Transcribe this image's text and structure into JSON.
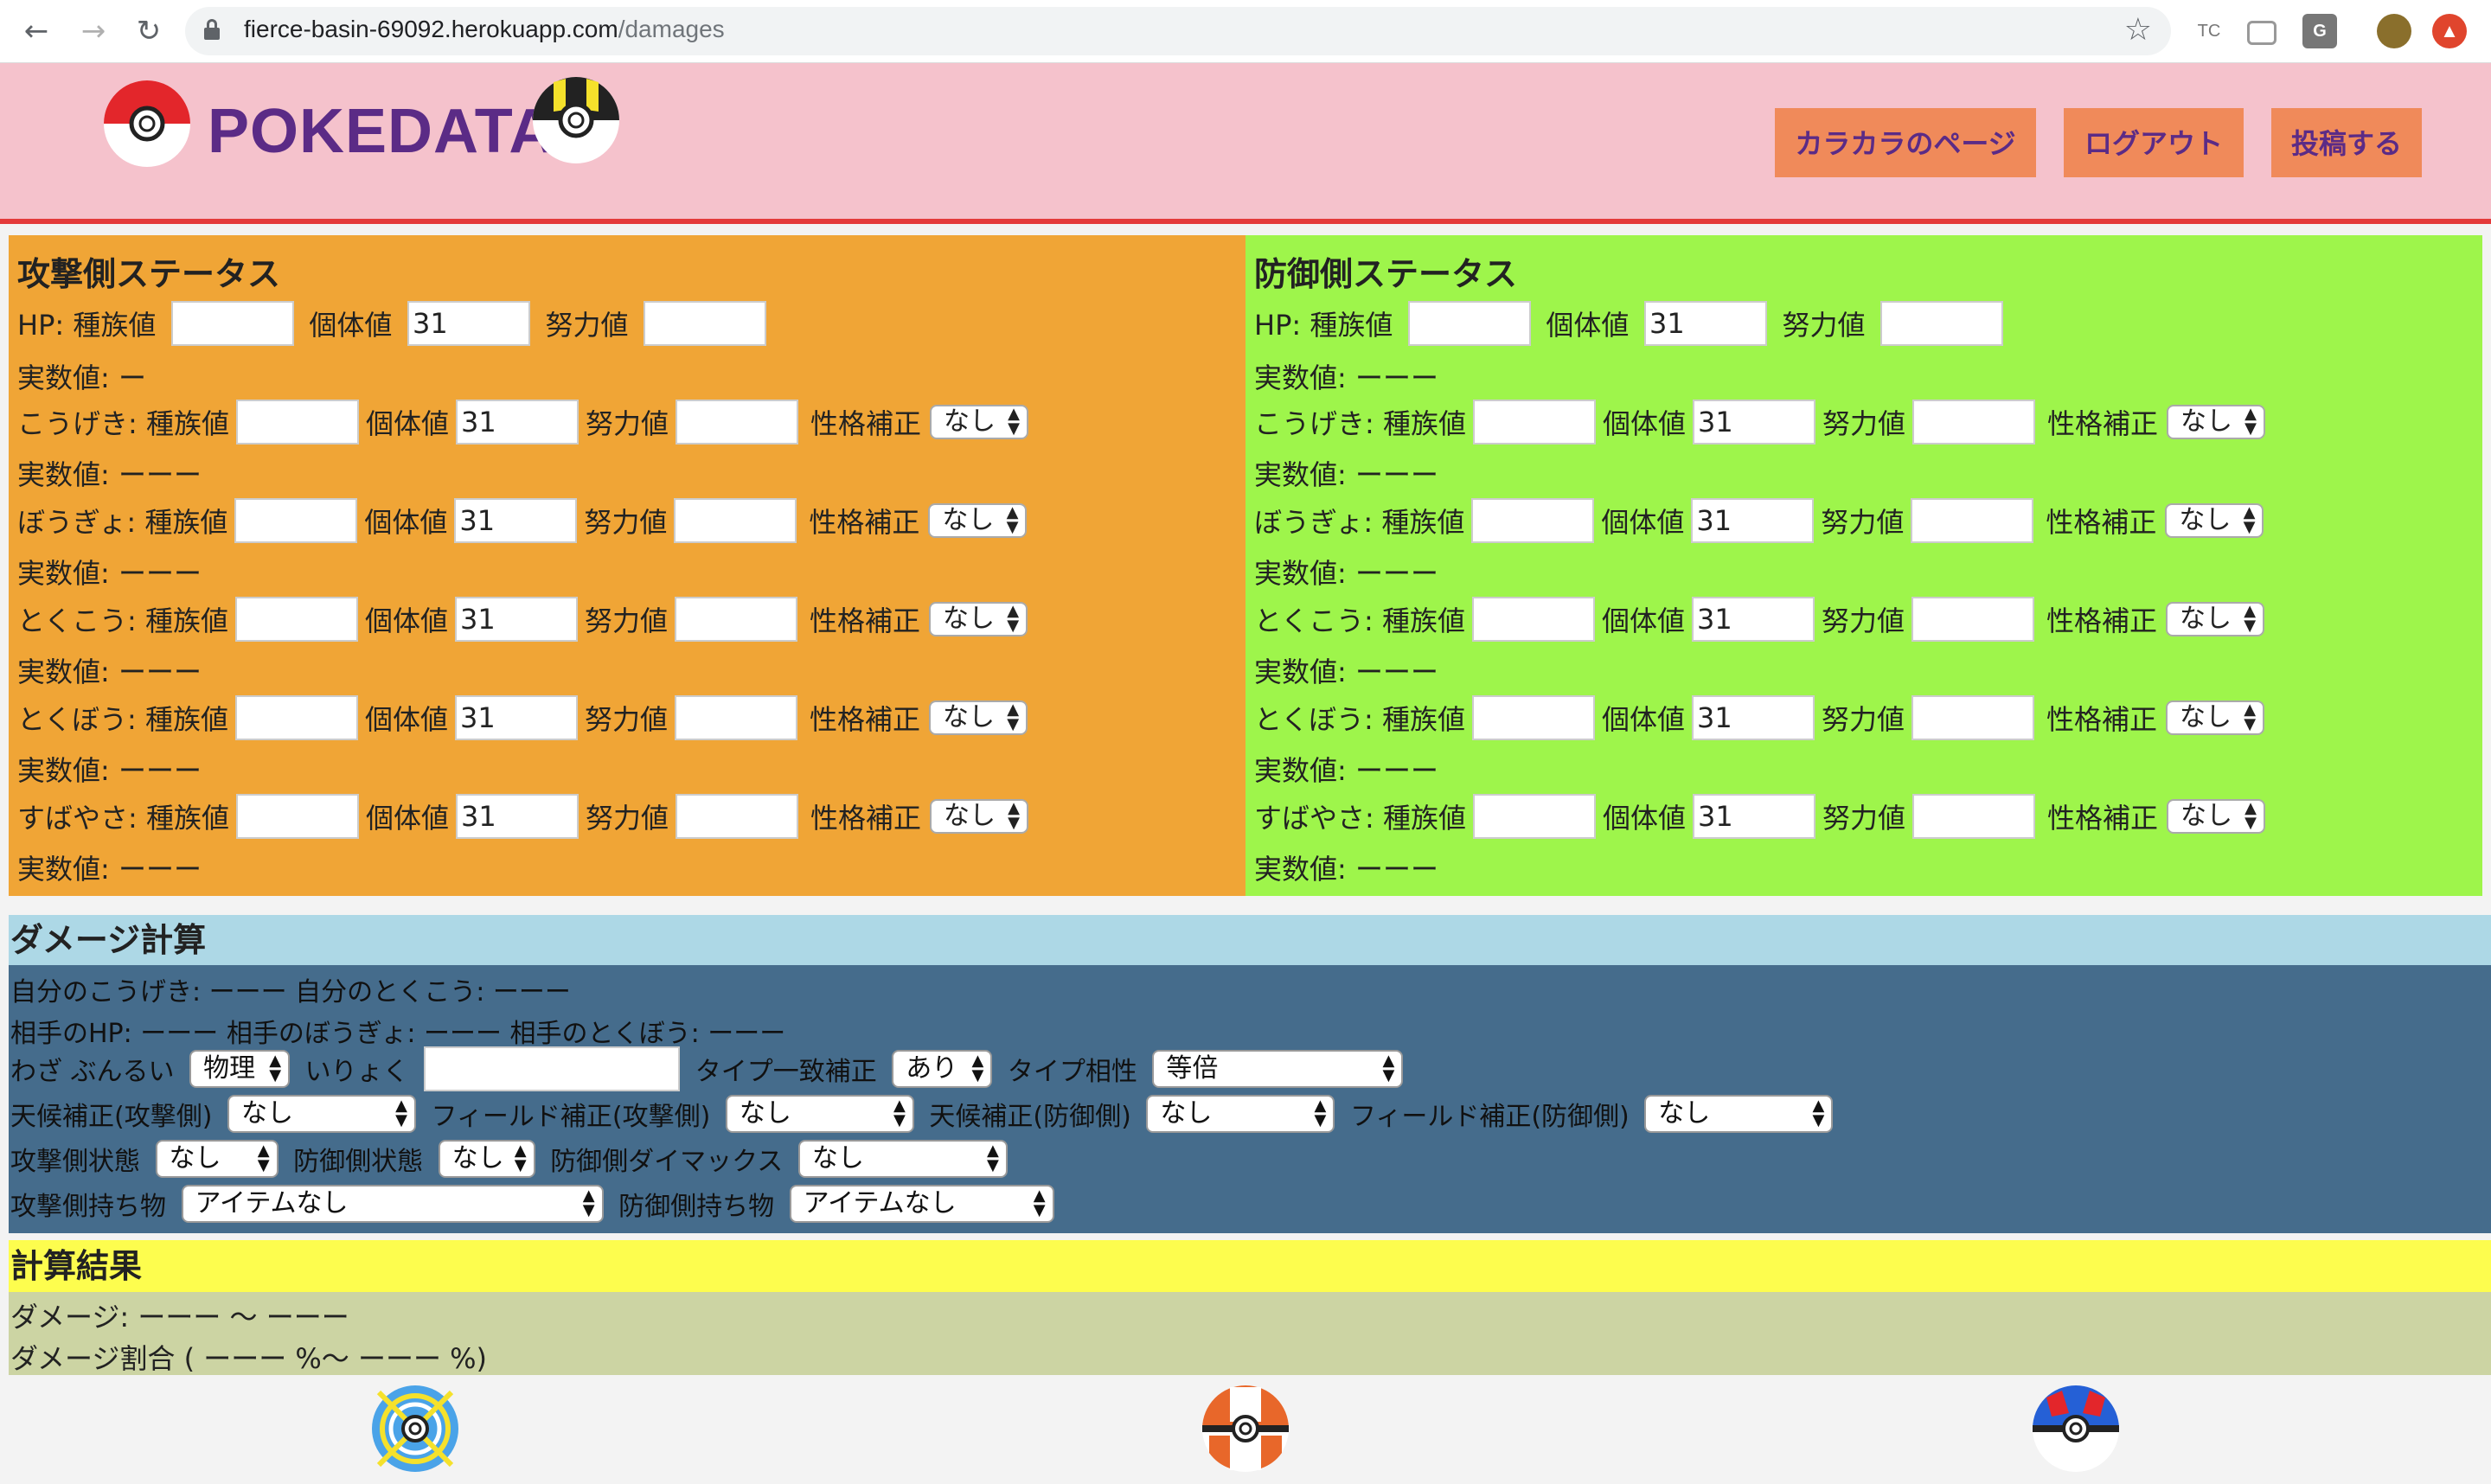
{
  "browser": {
    "url_host": "fierce-basin-69092.herokuapp.com",
    "url_path": "/damages",
    "ext_tc": "TC",
    "ext_g": "G"
  },
  "header": {
    "logo": "POKEDATA",
    "buttons": {
      "karakara": "カラカラのページ",
      "logout": "ログアウト",
      "post": "投稿する"
    }
  },
  "attacker": {
    "title": "攻撃側ステータス",
    "hp": {
      "label": "HP: 種族値",
      "iv_label": "個体値",
      "iv": "31",
      "ev_label": "努力値",
      "actual": "実数値: ー"
    },
    "stats": [
      {
        "label": "こうげき: 種族値",
        "iv_label": "個体値",
        "iv": "31",
        "ev_label": "努力値",
        "nature_label": "性格補正",
        "nature": "なし",
        "actual": "実数値: ーーー"
      },
      {
        "label": "ぼうぎょ: 種族値",
        "iv_label": "個体値",
        "iv": "31",
        "ev_label": "努力値",
        "nature_label": "性格補正",
        "nature": "なし",
        "actual": "実数値: ーーー"
      },
      {
        "label": "とくこう: 種族値",
        "iv_label": "個体値",
        "iv": "31",
        "ev_label": "努力値",
        "nature_label": "性格補正",
        "nature": "なし",
        "actual": "実数値: ーーー"
      },
      {
        "label": "とくぼう: 種族値",
        "iv_label": "個体値",
        "iv": "31",
        "ev_label": "努力値",
        "nature_label": "性格補正",
        "nature": "なし",
        "actual": "実数値: ーーー"
      },
      {
        "label": "すばやさ: 種族値",
        "iv_label": "個体値",
        "iv": "31",
        "ev_label": "努力値",
        "nature_label": "性格補正",
        "nature": "なし",
        "actual": "実数値: ーーー"
      }
    ]
  },
  "defender": {
    "title": "防御側ステータス",
    "hp": {
      "label": "HP: 種族値",
      "iv_label": "個体値",
      "iv": "31",
      "ev_label": "努力値",
      "actual": "実数値: ーーー"
    },
    "stats": [
      {
        "label": "こうげき: 種族値",
        "iv_label": "個体値",
        "iv": "31",
        "ev_label": "努力値",
        "nature_label": "性格補正",
        "nature": "なし",
        "actual": "実数値: ーーー"
      },
      {
        "label": "ぼうぎょ: 種族値",
        "iv_label": "個体値",
        "iv": "31",
        "ev_label": "努力値",
        "nature_label": "性格補正",
        "nature": "なし",
        "actual": "実数値: ーーー"
      },
      {
        "label": "とくこう: 種族値",
        "iv_label": "個体値",
        "iv": "31",
        "ev_label": "努力値",
        "nature_label": "性格補正",
        "nature": "なし",
        "actual": "実数値: ーーー"
      },
      {
        "label": "とくぼう: 種族値",
        "iv_label": "個体値",
        "iv": "31",
        "ev_label": "努力値",
        "nature_label": "性格補正",
        "nature": "なし",
        "actual": "実数値: ーーー"
      },
      {
        "label": "すばやさ: 種族値",
        "iv_label": "個体値",
        "iv": "31",
        "ev_label": "努力値",
        "nature_label": "性格補正",
        "nature": "なし",
        "actual": "実数値: ーーー"
      }
    ]
  },
  "damage": {
    "title": "ダメージ計算",
    "line1": "自分のこうげき: ーーー 自分のとくこう: ーーー",
    "line2": "相手のHP: ーーー 相手のぼうぎょ: ーーー 相手のとくぼう: ーーー",
    "move_class_label": "わざ ぶんるい",
    "move_class": "物理",
    "power_label": "いりょく",
    "stab_label": "タイプ一致補正",
    "stab": "あり",
    "type_eff_label": "タイプ相性",
    "type_eff": "等倍",
    "weather_att_label": "天候補正(攻撃側)",
    "weather_att": "なし",
    "field_att_label": "フィールド補正(攻撃側)",
    "field_att": "なし",
    "weather_def_label": "天候補正(防御側)",
    "weather_def": "なし",
    "field_def_label": "フィールド補正(防御側)",
    "field_def": "なし",
    "att_state_label": "攻撃側状態",
    "att_state": "なし",
    "def_state_label": "防御側状態",
    "def_state": "なし",
    "def_dmax_label": "防御側ダイマックス",
    "def_dmax": "なし",
    "att_item_label": "攻撃側持ち物",
    "att_item": "アイテムなし",
    "def_item_label": "防御側持ち物",
    "def_item": "アイテムなし"
  },
  "result": {
    "title": "計算結果",
    "damage": "ダメージ: ーーー 〜 ーーー",
    "ratio": "ダメージ割合 ( ーーー %〜 ーーー %)"
  }
}
